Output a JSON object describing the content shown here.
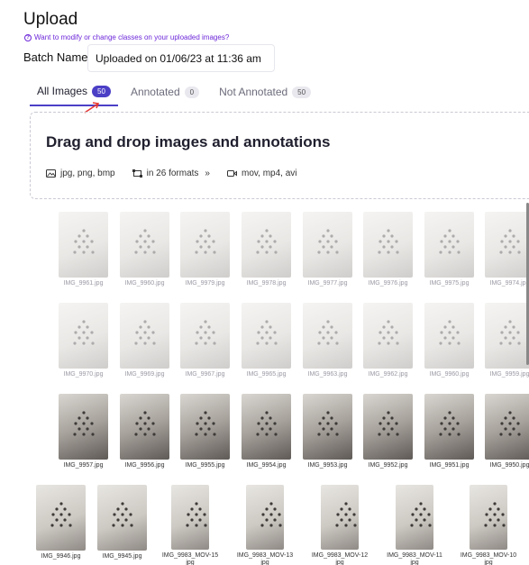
{
  "header": {
    "title": "Upload",
    "help_link": "Want to modify or change classes on your uploaded images?"
  },
  "batch": {
    "label": "Batch Name",
    "value": "Uploaded on 01/06/23 at 11:36 am"
  },
  "tabs": [
    {
      "label": "All Images",
      "count": "50",
      "active": true
    },
    {
      "label": "Annotated",
      "count": "0",
      "active": false
    },
    {
      "label": "Not Annotated",
      "count": "50",
      "active": false
    }
  ],
  "dropzone": {
    "title": "Drag and drop images and annotations",
    "image_formats": "jpg, png, bmp",
    "annotation_formats": "in 26 formats",
    "more_glyph": "»",
    "video_formats": "mov, mp4, avi"
  },
  "images": {
    "row1": [
      "IMG_9961.jpg",
      "IMG_9960.jpg",
      "IMG_9979.jpg",
      "IMG_9978.jpg",
      "IMG_9977.jpg",
      "IMG_9976.jpg",
      "IMG_9975.jpg",
      "IMG_9974.jpg"
    ],
    "row2": [
      "IMG_9970.jpg",
      "IMG_9969.jpg",
      "IMG_9967.jpg",
      "IMG_9965.jpg",
      "IMG_9963.jpg",
      "IMG_9962.jpg",
      "IMG_9960.jpg",
      "IMG_9959.jpg"
    ],
    "row3": [
      "IMG_9957.jpg",
      "IMG_9956.jpg",
      "IMG_9955.jpg",
      "IMG_9954.jpg",
      "IMG_9953.jpg",
      "IMG_9952.jpg",
      "IMG_9951.jpg",
      "IMG_9950.jpg"
    ],
    "row4": [
      "IMG_9946.jpg",
      "IMG_9945.jpg",
      "IMG_9983_MOV-15",
      "IMG_9983_MOV-13",
      "IMG_9983_MOV-12",
      "IMG_9983_MOV-11",
      "IMG_9983_MOV-10"
    ],
    "row4_ext": "jpg"
  },
  "colors": {
    "accent": "#4b3fc6",
    "help_link": "#6d28d9",
    "arrow": "#e53935"
  }
}
